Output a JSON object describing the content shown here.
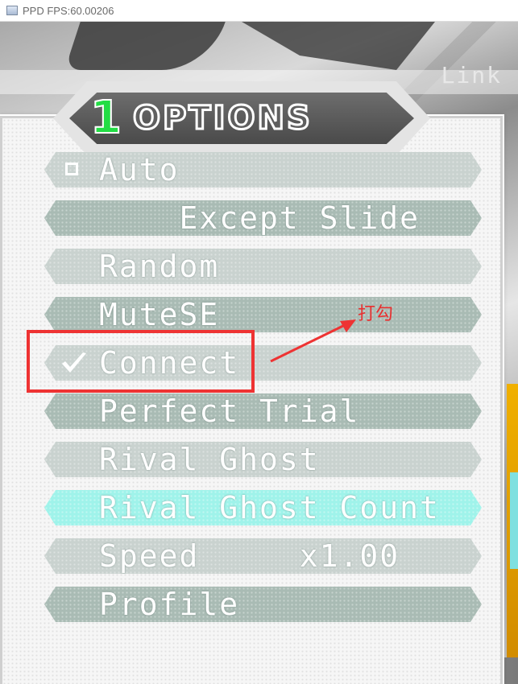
{
  "window": {
    "title": "PPD FPS:60.00206",
    "icon": "app-window-icon"
  },
  "background": {
    "link_text": "Link"
  },
  "header": {
    "number": "1",
    "title": "OPTIONS"
  },
  "menu": {
    "items": [
      {
        "label": "Auto",
        "icon": "checkbox-empty-icon",
        "style": "light"
      },
      {
        "label": "    Except Slide",
        "style": "dark"
      },
      {
        "label": "Random",
        "style": "light"
      },
      {
        "label": "MuteSE",
        "style": "dark"
      },
      {
        "label": "Connect",
        "icon": "checkmark-icon",
        "style": "light"
      },
      {
        "label": "Perfect Trial",
        "style": "dark"
      },
      {
        "label": "Rival Ghost",
        "style": "light"
      },
      {
        "label": "Rival Ghost Count",
        "style": "selected"
      },
      {
        "label": "Speed     x1.00",
        "style": "light"
      },
      {
        "label": "Profile",
        "style": "dark"
      }
    ]
  },
  "annotation": {
    "text": "打勾",
    "color": "#ee3333"
  },
  "colors": {
    "row_light": "#c9d2cf",
    "row_dark": "#a9bbb4",
    "row_selected": "#9ff3ea",
    "header_number": "#22dd44"
  }
}
